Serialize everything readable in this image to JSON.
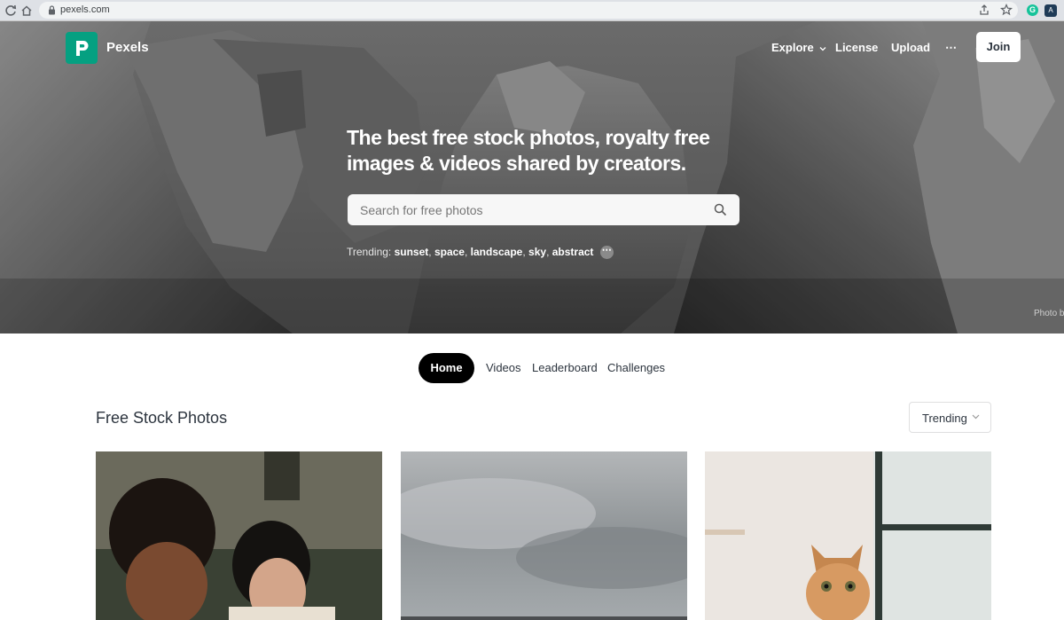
{
  "browser": {
    "url": "pexels.com"
  },
  "header": {
    "logo_text": "Pexels",
    "nav": {
      "explore": "Explore",
      "license": "License",
      "upload": "Upload",
      "more": "⋯"
    },
    "join_label": "Join"
  },
  "hero": {
    "headline_line1": "The best free stock photos, royalty free",
    "headline_line2": "images & videos shared by creators.",
    "search_placeholder": "Search for free photos",
    "trending_label": "Trending:",
    "trending_terms": [
      "sunset",
      "space",
      "landscape",
      "sky",
      "abstract"
    ],
    "photo_credit": "Photo b"
  },
  "tabs": [
    "Home",
    "Videos",
    "Leaderboard",
    "Challenges"
  ],
  "active_tab": "Home",
  "section": {
    "title": "Free Stock Photos",
    "sort_value": "Trending"
  },
  "colors": {
    "brand": "#05a081",
    "text": "#2c343e",
    "active_tab_bg": "#000000"
  },
  "icons": {
    "back": "arrow-left-icon",
    "reload": "reload-icon",
    "home": "home-icon",
    "lock": "lock-icon",
    "share": "share-icon",
    "bookmark": "star-icon",
    "search": "search-icon",
    "chevron": "chevron-down-icon"
  }
}
